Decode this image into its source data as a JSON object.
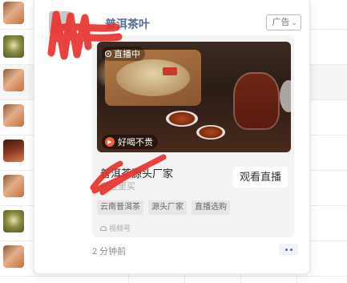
{
  "post": {
    "account_name": "普洱茶叶",
    "ad_label": "广告",
    "ad_label_icon": "chevron-down-icon",
    "media": {
      "live_badge": "直播中",
      "caption": "好喝不贵",
      "caption_icon": "speaker-icon"
    },
    "title": "普洱茶源头厂家",
    "subtitle": "在这里买",
    "cta_label": "观看直播",
    "tags": [
      "云南普洱茶",
      "源头厂家",
      "直播选购"
    ],
    "source_label": "视频号",
    "source_icon": "channels-icon",
    "timestamp": "2 分钟前",
    "more_icon": "more-dots-icon"
  },
  "colors": {
    "link_blue": "#576b95",
    "redaction_red": "#e8322e",
    "card_bg": "#f3f3f3"
  }
}
